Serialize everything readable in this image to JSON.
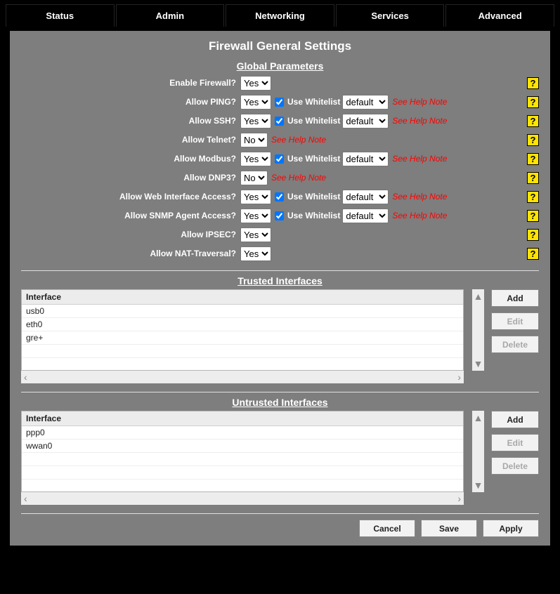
{
  "nav": [
    "Status",
    "Admin",
    "Networking",
    "Services",
    "Advanced"
  ],
  "title": "Firewall General Settings",
  "section_global": "Global Parameters",
  "section_trusted": "Trusted Interfaces",
  "section_untrusted": "Untrusted Interfaces",
  "yes": "Yes",
  "no": "No",
  "use_whitelist": "Use Whitelist",
  "wl_default": "default",
  "help_note": "See Help Note",
  "help_glyph": "?",
  "params": {
    "enable_fw": {
      "label": "Enable Firewall?",
      "value": "Yes"
    },
    "ping": {
      "label": "Allow PING?",
      "value": "Yes",
      "uw_checked": true,
      "wl": "default",
      "note": true
    },
    "ssh": {
      "label": "Allow SSH?",
      "value": "Yes",
      "uw_checked": true,
      "wl": "default",
      "note": true
    },
    "telnet": {
      "label": "Allow Telnet?",
      "value": "No",
      "note_only": true
    },
    "modbus": {
      "label": "Allow Modbus?",
      "value": "Yes",
      "uw_checked": true,
      "wl": "default",
      "note": true
    },
    "dnp3": {
      "label": "Allow DNP3?",
      "value": "No",
      "note_only": true
    },
    "web": {
      "label": "Allow Web Interface Access?",
      "value": "Yes",
      "uw_checked": true,
      "wl": "default",
      "note": true
    },
    "snmp": {
      "label": "Allow SNMP Agent Access?",
      "value": "Yes",
      "uw_checked": true,
      "wl": "default",
      "note": true
    },
    "ipsec": {
      "label": "Allow IPSEC?",
      "value": "Yes"
    },
    "natt": {
      "label": "Allow NAT-Traversal?",
      "value": "Yes"
    }
  },
  "iface_header": "Interface",
  "trusted": [
    "usb0",
    "eth0",
    "gre+"
  ],
  "untrusted": [
    "ppp0",
    "wwan0"
  ],
  "btn_add": "Add",
  "btn_edit": "Edit",
  "btn_delete": "Delete",
  "btn_cancel": "Cancel",
  "btn_save": "Save",
  "btn_apply": "Apply"
}
